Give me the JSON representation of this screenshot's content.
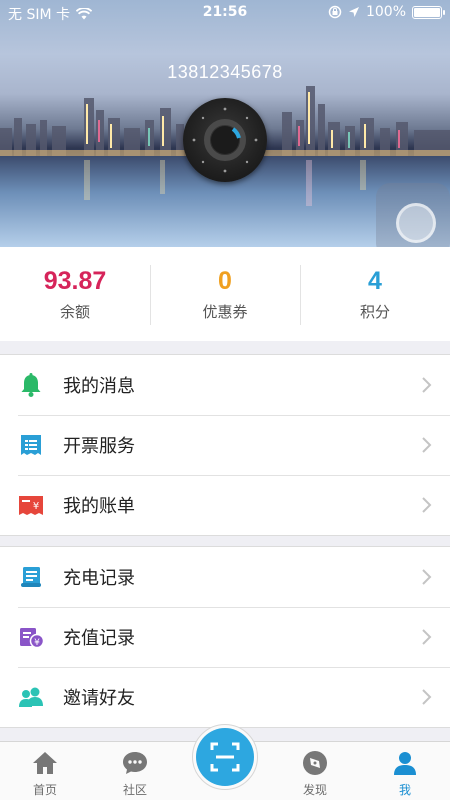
{
  "status_bar": {
    "carrier": "无 SIM 卡",
    "time": "21:56",
    "battery": "100%"
  },
  "profile": {
    "phone": "13812345678"
  },
  "stats": [
    {
      "value": "93.87",
      "label": "余额",
      "color": "#d6245a"
    },
    {
      "value": "0",
      "label": "优惠券",
      "color": "#f0a020"
    },
    {
      "value": "4",
      "label": "积分",
      "color": "#2a9fd6"
    }
  ],
  "menu": {
    "group1": [
      {
        "label": "我的消息",
        "icon": "bell-icon",
        "color": "#2bb968"
      },
      {
        "label": "开票服务",
        "icon": "invoice-icon",
        "color": "#2a9fd6"
      },
      {
        "label": "我的账单",
        "icon": "bill-icon",
        "color": "#e6463b"
      }
    ],
    "group2": [
      {
        "label": "充电记录",
        "icon": "record-icon",
        "color": "#2a9fd6"
      },
      {
        "label": "充值记录",
        "icon": "recharge-icon",
        "color": "#8a55c8"
      },
      {
        "label": "邀请好友",
        "icon": "friends-icon",
        "color": "#2bc3b5"
      }
    ]
  },
  "tabbar": {
    "tabs": [
      {
        "label": "首页",
        "icon": "home-icon"
      },
      {
        "label": "社区",
        "icon": "chat-icon"
      },
      {
        "label": "发现",
        "icon": "compass-icon"
      },
      {
        "label": "我",
        "icon": "person-icon",
        "active": true
      }
    ],
    "center_icon": "scan-icon",
    "accent": "#1b8fd2"
  }
}
